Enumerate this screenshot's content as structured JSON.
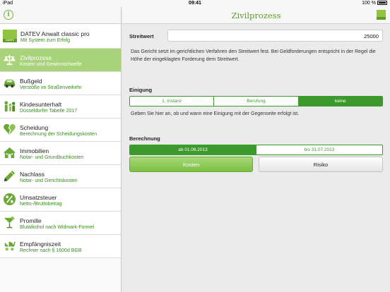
{
  "statusbar": {
    "left": "iPad",
    "time": "09:41",
    "battery": "100 %"
  },
  "sidebar": {
    "brand": {
      "logo_text": "DATEV",
      "title": "DATEV Anwalt classic pro",
      "subtitle": "Mit System zum Erfolg"
    },
    "items": [
      {
        "title": "Zivilprozess",
        "subtitle": "Kosten und Gewinnschwelle",
        "icon": "scales-icon",
        "active": true
      },
      {
        "title": "Bußgeld",
        "subtitle": "Verstöße im Straßenverkehr",
        "icon": "car-icon"
      },
      {
        "title": "Kindesunterhalt",
        "subtitle": "Düsseldorfer Tabelle 2017",
        "icon": "family-icon"
      },
      {
        "title": "Scheidung",
        "subtitle": "Berechnung der Scheidungskosten",
        "icon": "broken-heart-icon"
      },
      {
        "title": "Immobilien",
        "subtitle": "Notar- und Grundbuchkosten",
        "icon": "house-icon"
      },
      {
        "title": "Nachlass",
        "subtitle": "Notar- und Gerichtskosten",
        "icon": "pen-icon"
      },
      {
        "title": "Umsatzsteuer",
        "subtitle": "Netto-/Bruttobetrag",
        "icon": "percent-icon"
      },
      {
        "title": "Promille",
        "subtitle": "Blutalkohol nach Widmark-Formel",
        "icon": "cocktail-icon"
      },
      {
        "title": "Empfängniszeit",
        "subtitle": "Rechner nach § 1600d BGB",
        "icon": "stroller-icon"
      }
    ]
  },
  "main": {
    "title": "Zivilprozess",
    "streitwert": {
      "label": "Streitwert",
      "value": "25000",
      "description": "Das Gericht setzt im gerichtlichen Verfahren den Streitwert fest. Bei Geldforderungen entspricht in der Regel die Höhe der eingeklagten Forderung dem Streitwert."
    },
    "einigung": {
      "label": "Einigung",
      "options": [
        "1. Instanz",
        "Berufung",
        "keine"
      ],
      "selected": "keine",
      "description": "Geben Sie hier an, ob und wann eine Einigung mit der Gegenseite erfolgt ist."
    },
    "berechnung": {
      "label": "Berechnung",
      "options": [
        "ab 01.08.2013",
        "bis 31.07.2013"
      ],
      "selected": "ab 01.08.2013"
    },
    "buttons": {
      "kosten": "Kosten",
      "risiko": "Risiko"
    }
  },
  "colors": {
    "accent": "#3c9a2c",
    "active_item": "#a9d37a",
    "subtitle": "#3a8a20"
  }
}
